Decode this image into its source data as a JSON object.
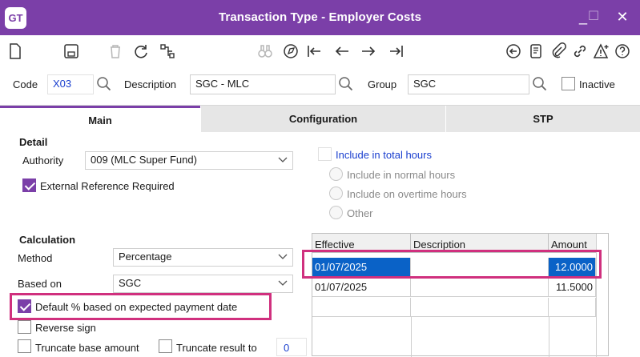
{
  "window": {
    "logo": "GT",
    "title": "Transaction Type - Employer Costs",
    "controls": {
      "minimize": "_",
      "maximize": "☐",
      "close": "✕"
    }
  },
  "toolbar": {
    "icons": [
      "new-icon",
      "save-icon",
      "delete-icon",
      "refresh-icon",
      "hierarchy-icon",
      "find-icon",
      "locate-icon",
      "first-record-icon",
      "previous-icon",
      "next-icon",
      "last-record-icon",
      "back-icon",
      "notes-icon",
      "attach-icon",
      "link-icon",
      "alert-icon",
      "help-icon"
    ]
  },
  "header": {
    "code_label": "Code",
    "code_value": "X03",
    "description_label": "Description",
    "description_value": "SGC - MLC",
    "group_label": "Group",
    "group_value": "SGC",
    "inactive_label": "Inactive"
  },
  "tabs": [
    {
      "label": "Main"
    },
    {
      "label": "Configuration"
    },
    {
      "label": "STP"
    }
  ],
  "detail": {
    "section": "Detail",
    "authority_label": "Authority",
    "authority_value": "009 (MLC Super Fund)",
    "external_ref_label": "External Reference Required"
  },
  "hours": {
    "include_total": "Include in total hours",
    "include_normal": "Include in normal hours",
    "include_overtime": "Include on overtime hours",
    "other": "Other"
  },
  "calculation": {
    "section": "Calculation",
    "method_label": "Method",
    "method_value": "Percentage",
    "based_on_label": "Based on",
    "based_on_value": "SGC",
    "default_pct_label": "Default % based on expected payment date",
    "reverse_sign_label": "Reverse sign",
    "truncate_base_label": "Truncate base amount",
    "truncate_result_label": "Truncate result to",
    "truncate_result_value": "0"
  },
  "rates_grid": {
    "columns": [
      "Effective",
      "Description",
      "Amount"
    ],
    "rows": [
      {
        "effective": "01/07/2025",
        "description": "",
        "amount": "12.0000"
      },
      {
        "effective": "01/07/2025",
        "description": "",
        "amount": "11.5000"
      }
    ]
  },
  "colors": {
    "accent": "#7b3fa8",
    "highlight": "#d0307e",
    "selection": "#0a62c7"
  }
}
